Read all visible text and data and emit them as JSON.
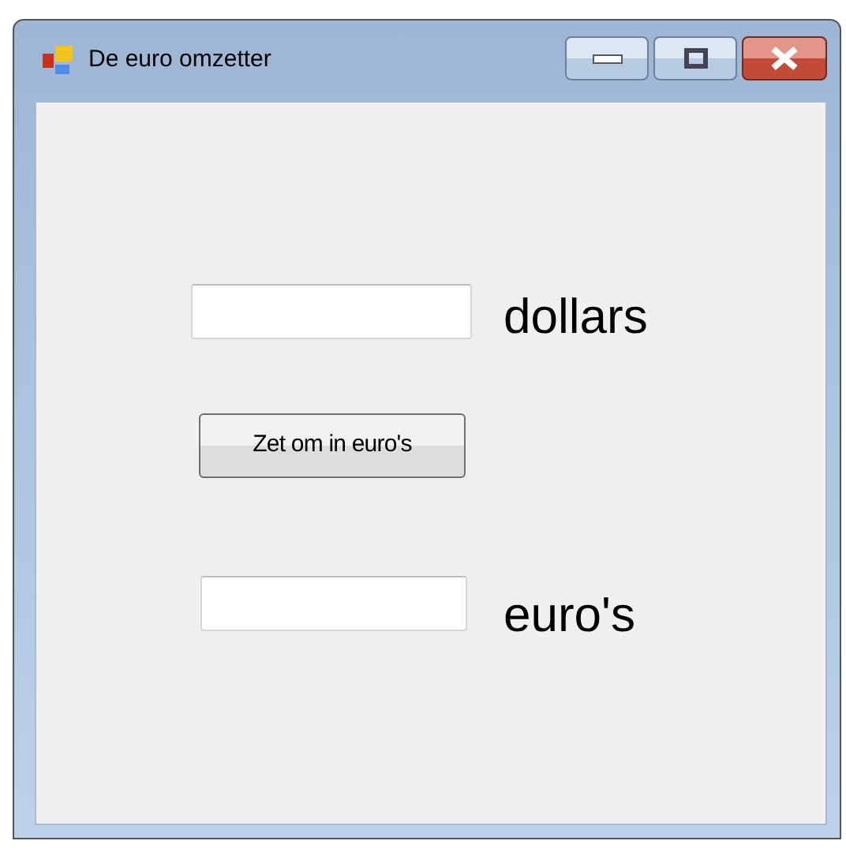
{
  "window": {
    "title": "De euro omzetter"
  },
  "dollars": {
    "label": "dollars"
  },
  "button": {
    "label": "Zet om in euro's"
  },
  "euros": {
    "label": "euro's"
  }
}
